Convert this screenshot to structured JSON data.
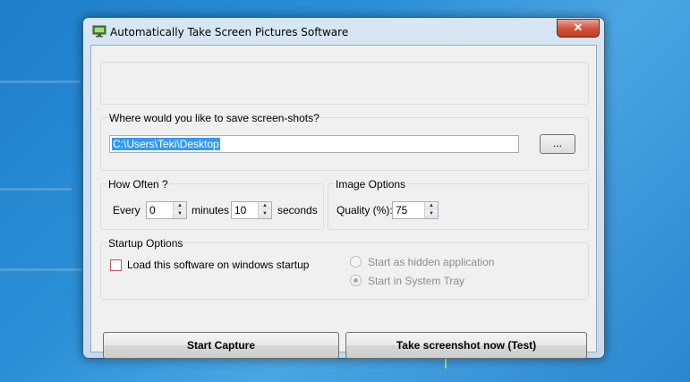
{
  "window": {
    "title": "Automatically Take Screen Pictures Software",
    "close_label": "✕"
  },
  "save": {
    "question": "Where would you like to save screen-shots?",
    "path": "C:\\Users\\Teki\\Desktop",
    "browse_label": "..."
  },
  "how_often": {
    "group_label": "How Often ?",
    "every_label": "Every",
    "minutes_value": "0",
    "minutes_label": "minutes",
    "seconds_value": "10",
    "seconds_label": "seconds"
  },
  "image_options": {
    "group_label": "Image Options",
    "quality_label": "Quality (%):",
    "quality_value": "75"
  },
  "startup": {
    "group_label": "Startup Options",
    "load_on_startup_label": "Load this software on windows startup",
    "load_on_startup_checked": false,
    "hidden_label": "Start as hidden application",
    "tray_label": "Start in System Tray",
    "selected_option": "Start in System Tray"
  },
  "buttons": {
    "start_capture": "Start Capture",
    "take_screenshot": "Take screenshot now (Test)"
  },
  "icons": {
    "app": "monitor-icon",
    "close": "close-icon",
    "spin_up": "arrow-up-icon",
    "spin_down": "arrow-down-icon"
  }
}
